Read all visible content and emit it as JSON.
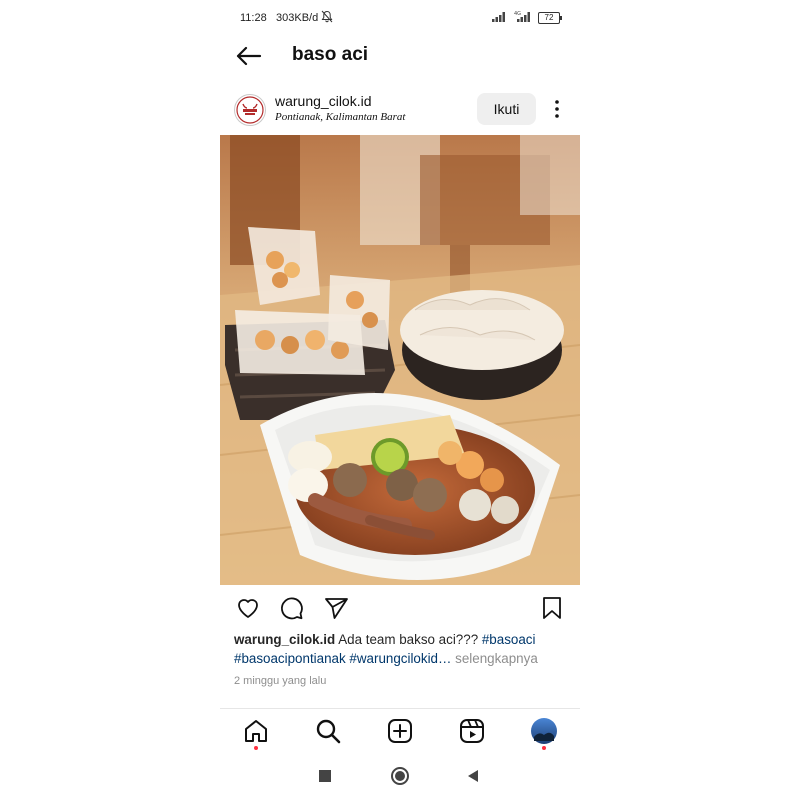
{
  "status_bar": {
    "time": "11:28",
    "net_speed": "303KB/d",
    "battery": "72",
    "signal1_icon": "signal-bars-icon",
    "signal2_icon": "signal-4g-icon",
    "alarm_icon": "bell-off-icon"
  },
  "header": {
    "title": "baso aci",
    "back_icon": "arrow-left-icon"
  },
  "post": {
    "username": "warung_cilok.id",
    "location": "Pontianak, Kalimantan Barat",
    "follow_label": "Ikuti",
    "more_icon": "more-vertical-icon",
    "image_alt": "baso aci bowl",
    "caption": {
      "username": "warung_cilok.id",
      "text": "Ada team bakso aci??? ",
      "tags": [
        "#basoaci",
        "#basoacipontianak",
        "#warungcilokid…"
      ],
      "more_label": "selengkapnya"
    },
    "time_ago": "2 minggu yang lalu"
  },
  "actions": {
    "like_icon": "heart-icon",
    "comment_icon": "comment-icon",
    "share_icon": "send-icon",
    "save_icon": "bookmark-icon"
  },
  "bottom_nav": {
    "items": [
      "home-icon",
      "search-icon",
      "add-post-icon",
      "reels-icon",
      "profile-avatar"
    ]
  },
  "system_nav": {
    "items": [
      "recents-square-icon",
      "home-circle-icon",
      "back-triangle-icon"
    ]
  },
  "colors": {
    "text": "#262626",
    "hashtag": "#00376b",
    "muted": "#8e8e8e",
    "notification_dot": "#ff3040",
    "follow_bg": "#efefef"
  }
}
